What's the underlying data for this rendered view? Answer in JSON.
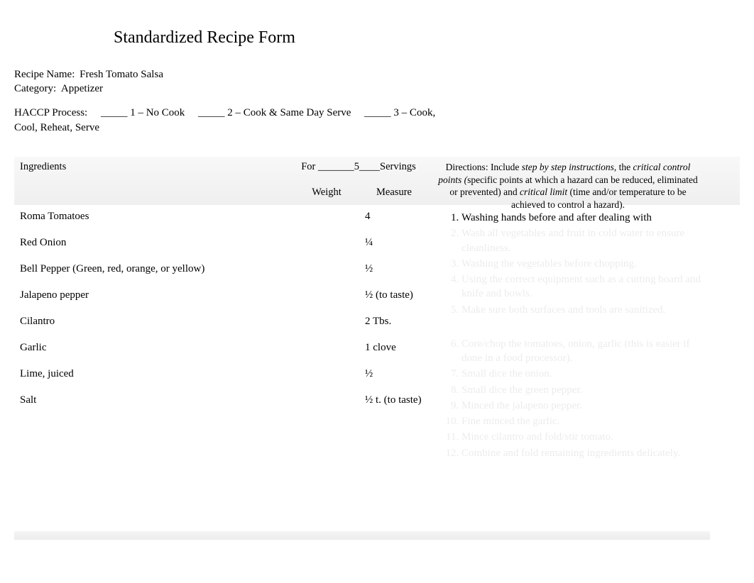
{
  "title": "Standardized Recipe Form",
  "meta": {
    "recipe_name_label": "Recipe Name:",
    "recipe_name_value": "Fresh Tomato Salsa",
    "category_label": "Category:",
    "category_value": "Appetizer",
    "haccp_text": "HACCP Process:  _____ 1 – No Cook  _____ 2 – Cook & Same Day Serve  _____ 3 – Cook, Cool, Reheat, Serve"
  },
  "headers": {
    "ingredients": "Ingredients",
    "servings_prefix": "For _______",
    "servings_count": "5",
    "servings_suffix": "____Servings",
    "weight": "Weight",
    "measure": "Measure",
    "directions_prefix": "Directions: Include ",
    "directions_step": "step by step instructions",
    "directions_mid1": ", the ",
    "directions_ccp": "critical control points (",
    "directions_mid2": "specific points at which a hazard can be reduced, eliminated or prevented) and ",
    "directions_cl": "critical limit ",
    "directions_mid3": "(time and/or temperature to be achieved to control a hazard)."
  },
  "ingredients": [
    {
      "name": "Roma Tomatoes",
      "weight": "",
      "measure": "4"
    },
    {
      "name": "Red Onion",
      "weight": "",
      "measure": "¼"
    },
    {
      "name": "Bell Pepper (Green, red, orange, or yellow)",
      "weight": "",
      "measure": "½"
    },
    {
      "name": "Jalapeno pepper",
      "weight": "",
      "measure": "½ (to taste)"
    },
    {
      "name": "Cilantro",
      "weight": "",
      "measure": "2 Tbs."
    },
    {
      "name": "Garlic",
      "weight": "",
      "measure": "1 clove"
    },
    {
      "name": "Lime, juiced",
      "weight": "",
      "measure": "½"
    },
    {
      "name": "Salt",
      "weight": "",
      "measure": "½ t. (to taste)"
    }
  ],
  "directions": [
    {
      "text": "Washing hands before and after dealing with",
      "visible": true
    },
    {
      "text": "Wash all vegetables and fruit in cold water to ensure cleanliness.",
      "visible": false
    },
    {
      "text": "Washing the vegetables before chopping.",
      "visible": false
    },
    {
      "text": "Using the correct equipment such as a cutting board and knife and bowls.",
      "visible": false
    },
    {
      "text": "Make sure both surfaces and tools are sanitized.",
      "visible": false
    },
    {
      "text": "",
      "visible": false
    },
    {
      "text": "Core/chop the tomatoes, onion, garlic (this is easier if done in a food processor).",
      "visible": false
    },
    {
      "text": "Small dice the onion.",
      "visible": false
    },
    {
      "text": "Small dice the green pepper.",
      "visible": false
    },
    {
      "text": "Minced the jalapeno pepper.",
      "visible": false
    },
    {
      "text": "Fine minced the garlic.",
      "visible": false
    },
    {
      "text": "Mince cilantro and fold/stir tomato.",
      "visible": false
    },
    {
      "text": "Combine and fold remaining ingredients delicately.",
      "visible": false
    }
  ]
}
